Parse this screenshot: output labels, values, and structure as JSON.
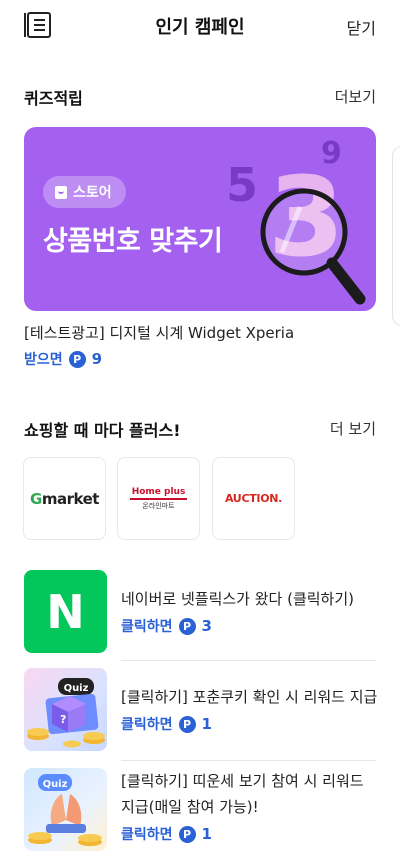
{
  "header": {
    "title": "인기 캠페인",
    "close_label": "닫기",
    "menu_icon": "menu-list-icon"
  },
  "quiz_section": {
    "title": "퀴즈적립",
    "more_label": "더보기",
    "banner": {
      "badge_label": "스토어",
      "badge_icon": "shopping-bag-icon",
      "headline": "상품번호 맞추기",
      "deco_digits": [
        "5",
        "3",
        "9"
      ],
      "bg_color": "#a461f0"
    },
    "campaign": {
      "title": "[테스트광고] 디지털 시계 Widget Xperia",
      "reward_label": "받으면",
      "points": "9"
    }
  },
  "shopping_section": {
    "title": "쇼핑할 때 마다 플러스!",
    "more_label": "더 보기",
    "shops": [
      {
        "name": "Gmarket",
        "logo_lead": "G",
        "logo_rest": "market"
      },
      {
        "name": "Home plus",
        "sub": "온라인마트"
      },
      {
        "name": "AUCTION."
      }
    ]
  },
  "campaign_list": [
    {
      "title": "네이버로 넷플릭스가 왔다 (클릭하기)",
      "reward_label": "클릭하면",
      "points": "3",
      "thumb_letter": "N",
      "thumb_color": "#03c75a"
    },
    {
      "title": "[클릭하기] 포춘쿠키 확인 시 리워드 지급",
      "reward_label": "클릭하면",
      "points": "1",
      "thumb_tag": "Quiz"
    },
    {
      "title": "[클릭하기] 띠운세 보기 참여 시 리워드 지급(매일 참여 가능)!",
      "reward_label": "클릭하면",
      "points": "1",
      "thumb_tag": "Quiz"
    }
  ],
  "point_symbol": "P",
  "colors": {
    "accent": "#2b61d6",
    "banner": "#a461f0",
    "naver_green": "#03c75a"
  }
}
